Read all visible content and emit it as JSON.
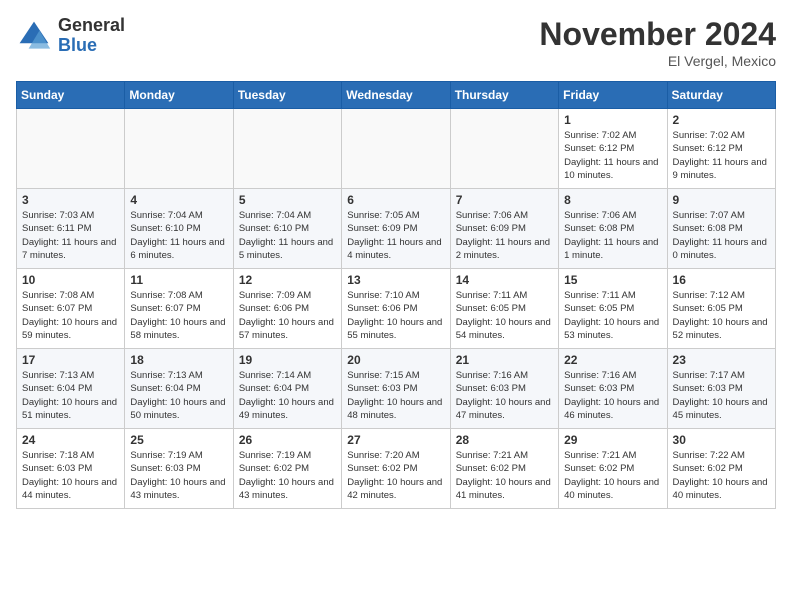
{
  "logo": {
    "general": "General",
    "blue": "Blue"
  },
  "title": "November 2024",
  "location": "El Vergel, Mexico",
  "days_of_week": [
    "Sunday",
    "Monday",
    "Tuesday",
    "Wednesday",
    "Thursday",
    "Friday",
    "Saturday"
  ],
  "weeks": [
    [
      {
        "day": "",
        "info": ""
      },
      {
        "day": "",
        "info": ""
      },
      {
        "day": "",
        "info": ""
      },
      {
        "day": "",
        "info": ""
      },
      {
        "day": "",
        "info": ""
      },
      {
        "day": "1",
        "info": "Sunrise: 7:02 AM\nSunset: 6:12 PM\nDaylight: 11 hours and 10 minutes."
      },
      {
        "day": "2",
        "info": "Sunrise: 7:02 AM\nSunset: 6:12 PM\nDaylight: 11 hours and 9 minutes."
      }
    ],
    [
      {
        "day": "3",
        "info": "Sunrise: 7:03 AM\nSunset: 6:11 PM\nDaylight: 11 hours and 7 minutes."
      },
      {
        "day": "4",
        "info": "Sunrise: 7:04 AM\nSunset: 6:10 PM\nDaylight: 11 hours and 6 minutes."
      },
      {
        "day": "5",
        "info": "Sunrise: 7:04 AM\nSunset: 6:10 PM\nDaylight: 11 hours and 5 minutes."
      },
      {
        "day": "6",
        "info": "Sunrise: 7:05 AM\nSunset: 6:09 PM\nDaylight: 11 hours and 4 minutes."
      },
      {
        "day": "7",
        "info": "Sunrise: 7:06 AM\nSunset: 6:09 PM\nDaylight: 11 hours and 2 minutes."
      },
      {
        "day": "8",
        "info": "Sunrise: 7:06 AM\nSunset: 6:08 PM\nDaylight: 11 hours and 1 minute."
      },
      {
        "day": "9",
        "info": "Sunrise: 7:07 AM\nSunset: 6:08 PM\nDaylight: 11 hours and 0 minutes."
      }
    ],
    [
      {
        "day": "10",
        "info": "Sunrise: 7:08 AM\nSunset: 6:07 PM\nDaylight: 10 hours and 59 minutes."
      },
      {
        "day": "11",
        "info": "Sunrise: 7:08 AM\nSunset: 6:07 PM\nDaylight: 10 hours and 58 minutes."
      },
      {
        "day": "12",
        "info": "Sunrise: 7:09 AM\nSunset: 6:06 PM\nDaylight: 10 hours and 57 minutes."
      },
      {
        "day": "13",
        "info": "Sunrise: 7:10 AM\nSunset: 6:06 PM\nDaylight: 10 hours and 55 minutes."
      },
      {
        "day": "14",
        "info": "Sunrise: 7:11 AM\nSunset: 6:05 PM\nDaylight: 10 hours and 54 minutes."
      },
      {
        "day": "15",
        "info": "Sunrise: 7:11 AM\nSunset: 6:05 PM\nDaylight: 10 hours and 53 minutes."
      },
      {
        "day": "16",
        "info": "Sunrise: 7:12 AM\nSunset: 6:05 PM\nDaylight: 10 hours and 52 minutes."
      }
    ],
    [
      {
        "day": "17",
        "info": "Sunrise: 7:13 AM\nSunset: 6:04 PM\nDaylight: 10 hours and 51 minutes."
      },
      {
        "day": "18",
        "info": "Sunrise: 7:13 AM\nSunset: 6:04 PM\nDaylight: 10 hours and 50 minutes."
      },
      {
        "day": "19",
        "info": "Sunrise: 7:14 AM\nSunset: 6:04 PM\nDaylight: 10 hours and 49 minutes."
      },
      {
        "day": "20",
        "info": "Sunrise: 7:15 AM\nSunset: 6:03 PM\nDaylight: 10 hours and 48 minutes."
      },
      {
        "day": "21",
        "info": "Sunrise: 7:16 AM\nSunset: 6:03 PM\nDaylight: 10 hours and 47 minutes."
      },
      {
        "day": "22",
        "info": "Sunrise: 7:16 AM\nSunset: 6:03 PM\nDaylight: 10 hours and 46 minutes."
      },
      {
        "day": "23",
        "info": "Sunrise: 7:17 AM\nSunset: 6:03 PM\nDaylight: 10 hours and 45 minutes."
      }
    ],
    [
      {
        "day": "24",
        "info": "Sunrise: 7:18 AM\nSunset: 6:03 PM\nDaylight: 10 hours and 44 minutes."
      },
      {
        "day": "25",
        "info": "Sunrise: 7:19 AM\nSunset: 6:03 PM\nDaylight: 10 hours and 43 minutes."
      },
      {
        "day": "26",
        "info": "Sunrise: 7:19 AM\nSunset: 6:02 PM\nDaylight: 10 hours and 43 minutes."
      },
      {
        "day": "27",
        "info": "Sunrise: 7:20 AM\nSunset: 6:02 PM\nDaylight: 10 hours and 42 minutes."
      },
      {
        "day": "28",
        "info": "Sunrise: 7:21 AM\nSunset: 6:02 PM\nDaylight: 10 hours and 41 minutes."
      },
      {
        "day": "29",
        "info": "Sunrise: 7:21 AM\nSunset: 6:02 PM\nDaylight: 10 hours and 40 minutes."
      },
      {
        "day": "30",
        "info": "Sunrise: 7:22 AM\nSunset: 6:02 PM\nDaylight: 10 hours and 40 minutes."
      }
    ]
  ]
}
